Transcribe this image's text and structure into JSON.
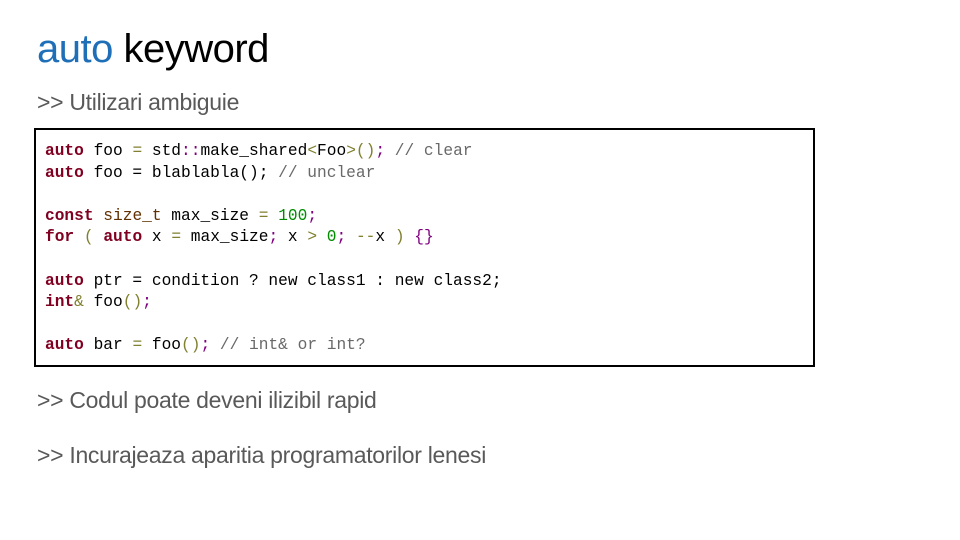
{
  "slide": {
    "title": {
      "accent": "auto",
      "rest": " keyword",
      "accent_color": "#1f6fb8"
    },
    "bullets": [
      ">> Utilizari ambiguie",
      ">> Codul poate deveni ilizibil rapid",
      ">> Incurajeaza aparitia programatorilor lenesi"
    ],
    "code_lines": [
      [
        [
          "kw",
          "auto"
        ],
        [
          "txt",
          " foo "
        ],
        [
          "op",
          "="
        ],
        [
          "txt",
          " std"
        ],
        [
          "punc",
          "::"
        ],
        [
          "txt",
          "make_shared"
        ],
        [
          "op",
          "<"
        ],
        [
          "txt",
          "Foo"
        ],
        [
          "op",
          ">"
        ],
        [
          "op",
          "()"
        ],
        [
          "punc",
          ";"
        ],
        [
          "txt",
          " "
        ],
        [
          "cmt",
          "// clear"
        ]
      ],
      [
        [
          "kw",
          "auto"
        ],
        [
          "txt",
          " foo = blablabla(); "
        ],
        [
          "cmt",
          "// unclear"
        ]
      ],
      [],
      [
        [
          "kw",
          "const"
        ],
        [
          "txt",
          " "
        ],
        [
          "type",
          "size_t"
        ],
        [
          "txt",
          " max_size "
        ],
        [
          "op",
          "="
        ],
        [
          "txt",
          " "
        ],
        [
          "num",
          "100"
        ],
        [
          "punc",
          ";"
        ]
      ],
      [
        [
          "kw",
          "for"
        ],
        [
          "txt",
          " "
        ],
        [
          "op",
          "("
        ],
        [
          "txt",
          " "
        ],
        [
          "kw",
          "auto"
        ],
        [
          "txt",
          " x "
        ],
        [
          "op",
          "="
        ],
        [
          "txt",
          " max_size"
        ],
        [
          "punc",
          ";"
        ],
        [
          "txt",
          " x "
        ],
        [
          "op",
          ">"
        ],
        [
          "txt",
          " "
        ],
        [
          "num",
          "0"
        ],
        [
          "punc",
          ";"
        ],
        [
          "txt",
          " "
        ],
        [
          "op",
          "--"
        ],
        [
          "txt",
          "x "
        ],
        [
          "op",
          ")"
        ],
        [
          "txt",
          " "
        ],
        [
          "punc",
          "{}"
        ]
      ],
      [],
      [
        [
          "kw",
          "auto"
        ],
        [
          "txt",
          " ptr = condition ? new class1 : new class2;"
        ]
      ],
      [
        [
          "kw",
          "int"
        ],
        [
          "op",
          "&"
        ],
        [
          "txt",
          " foo"
        ],
        [
          "op",
          "()"
        ],
        [
          "punc",
          ";"
        ]
      ],
      [],
      [
        [
          "kw",
          "auto"
        ],
        [
          "txt",
          " bar "
        ],
        [
          "op",
          "="
        ],
        [
          "txt",
          " foo"
        ],
        [
          "op",
          "()"
        ],
        [
          "punc",
          ";"
        ],
        [
          "txt",
          " "
        ],
        [
          "cmt",
          "// int& or int?"
        ]
      ]
    ]
  }
}
